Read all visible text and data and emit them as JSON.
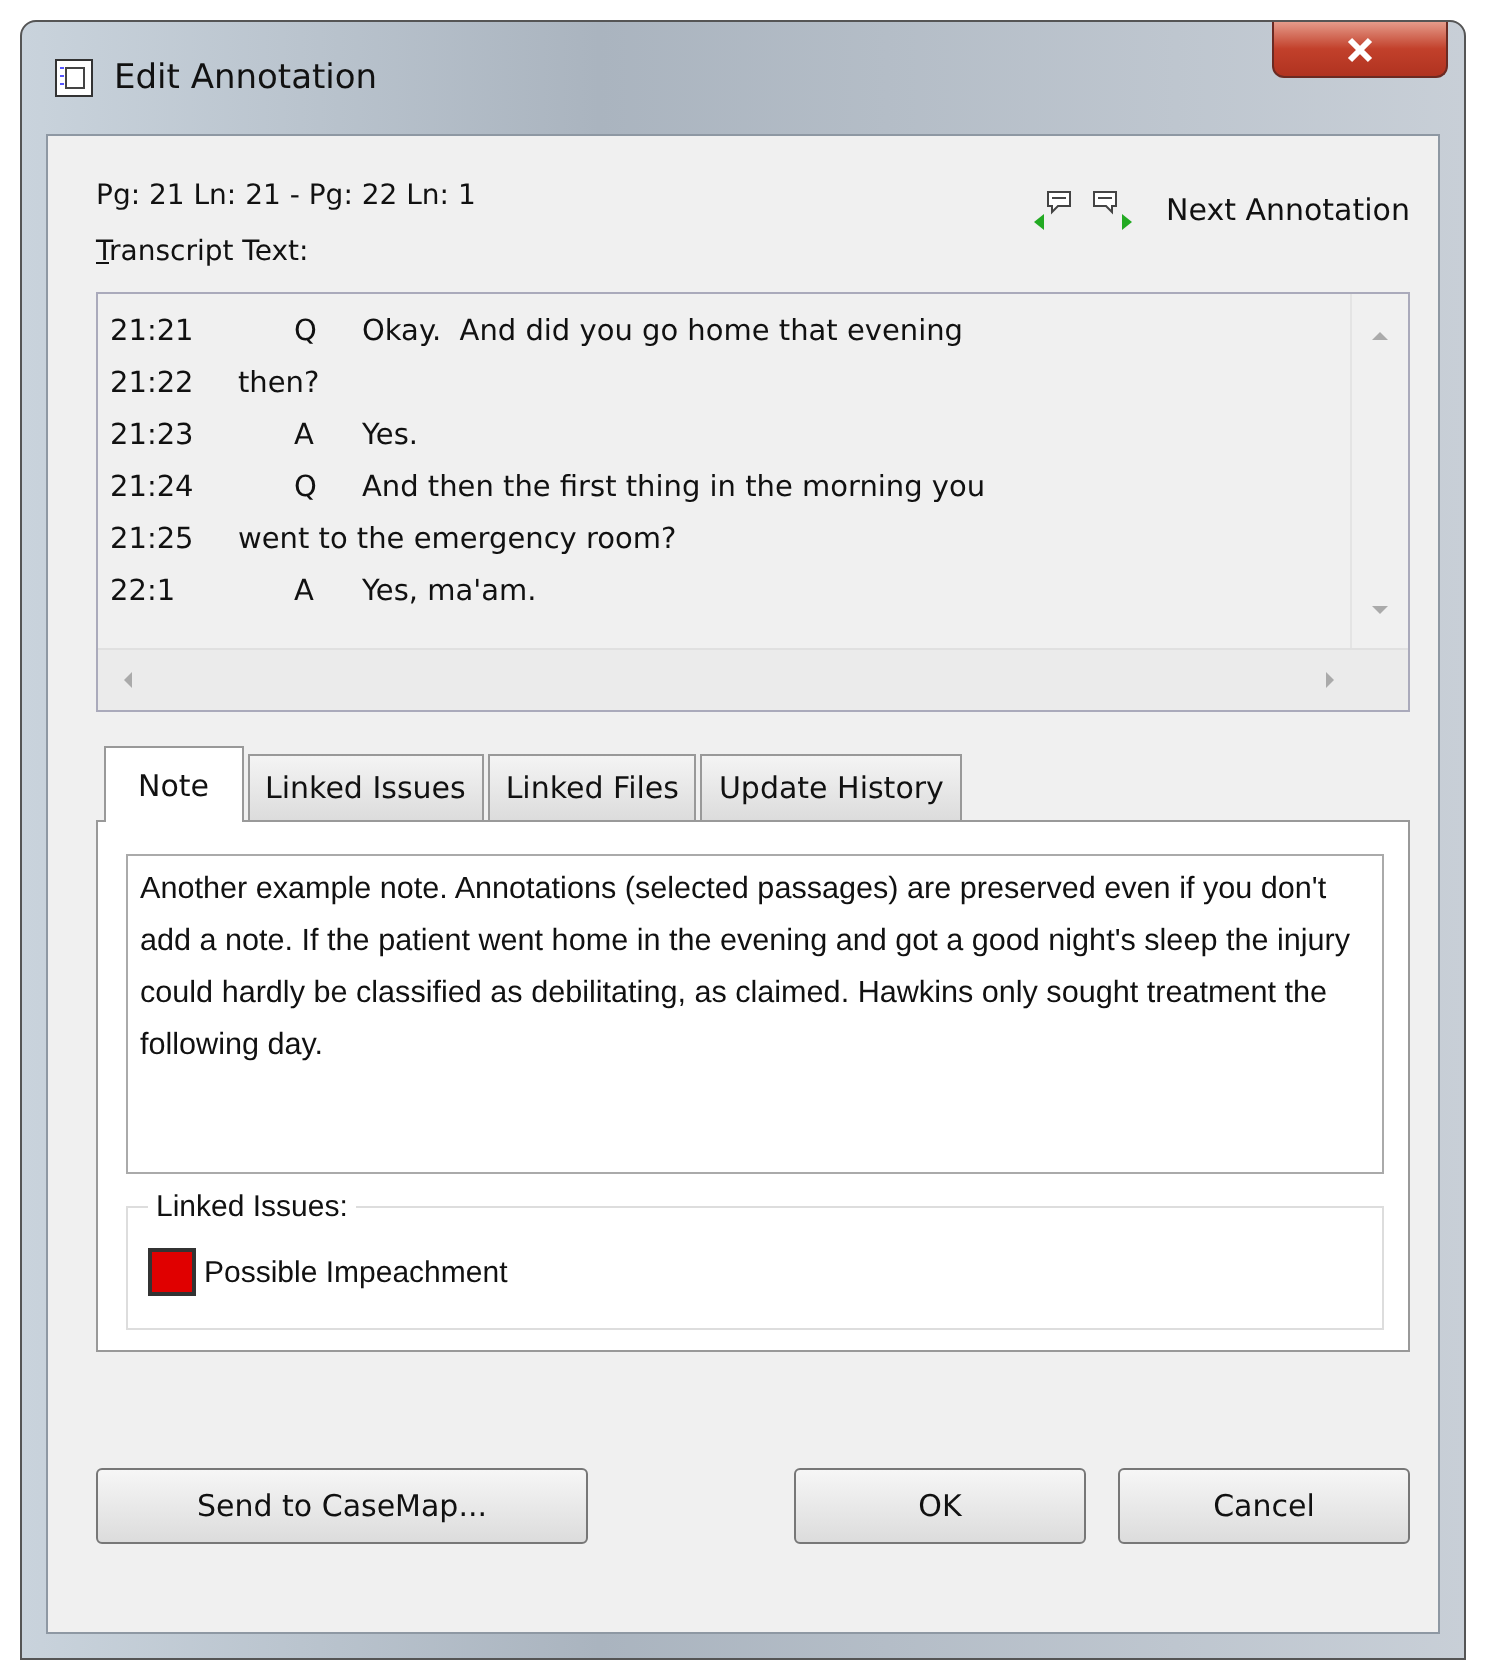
{
  "window": {
    "title": "Edit Annotation"
  },
  "range": "Pg: 21 Ln: 21 - Pg: 22 Ln: 1",
  "next_annotation": "Next Annotation",
  "transcript": {
    "label": "Transcript Text:",
    "lines": [
      {
        "line": "21:21",
        "speaker": "Q",
        "text": "Okay.  And did you go home that evening"
      },
      {
        "line": "21:22",
        "text": "then?"
      },
      {
        "line": "21:23",
        "speaker": "A",
        "text": "Yes."
      },
      {
        "line": "21:24",
        "speaker": "Q",
        "text": "And then the first thing in the morning you"
      },
      {
        "line": "21:25",
        "text": "went to the emergency room?"
      },
      {
        "line": "22:1",
        "speaker": "A",
        "text": "Yes, ma'am."
      }
    ]
  },
  "tabs": [
    {
      "label": "Note",
      "selected": true
    },
    {
      "label": "Linked Issues",
      "selected": false
    },
    {
      "label": "Linked Files",
      "selected": false
    },
    {
      "label": "Update History",
      "selected": false
    }
  ],
  "note": "Another example note.  Annotations (selected passages) are preserved even if you don't add a note.  If the patient went home in the evening and got a good night's sleep the injury could hardly be classified as debilitating, as claimed.  Hawkins only sought treatment the following day.",
  "linked_issues": {
    "label": "Linked Issues:",
    "items": [
      {
        "name": "Possible Impeachment",
        "color": "#e00000"
      }
    ]
  },
  "buttons": {
    "send": "Send to CaseMap...",
    "ok": "OK",
    "cancel": "Cancel"
  }
}
